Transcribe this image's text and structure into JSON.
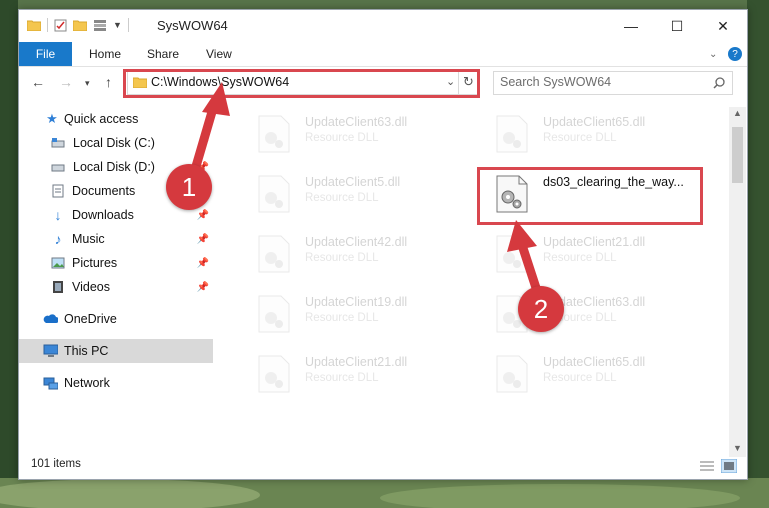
{
  "window": {
    "title": "SysWOW64",
    "minimize_glyph": "—",
    "maximize_glyph": "☐",
    "close_glyph": "✕"
  },
  "ribbon": {
    "tabs": [
      "File",
      "Home",
      "Share",
      "View"
    ]
  },
  "nav": {
    "address": "C:\\Windows\\SysWOW64",
    "search_placeholder": "Search SysWOW64"
  },
  "sidebar": {
    "items": [
      {
        "label": "Quick access",
        "icon": "star-icon"
      },
      {
        "label": "Local Disk (C:)",
        "icon": "drive-icon"
      },
      {
        "label": "Local Disk (D:)",
        "icon": "drive-icon"
      },
      {
        "label": "Documents",
        "icon": "documents-icon"
      },
      {
        "label": "Downloads",
        "icon": "download-icon"
      },
      {
        "label": "Music",
        "icon": "music-icon"
      },
      {
        "label": "Pictures",
        "icon": "pictures-icon"
      },
      {
        "label": "Videos",
        "icon": "videos-icon"
      },
      {
        "label": "OneDrive",
        "icon": "cloud-icon"
      },
      {
        "label": "This PC",
        "icon": "computer-icon"
      },
      {
        "label": "Network",
        "icon": "network-icon"
      }
    ]
  },
  "files": [
    {
      "name": "UpdateClient63.dll",
      "type": "Resource DLL"
    },
    {
      "name": "UpdateClient65.dll",
      "type": "Resource DLL"
    },
    {
      "name": "UpdateClient5.dll",
      "type": "Resource DLL"
    },
    {
      "name": "ds03_clearing_the_way...",
      "type": ""
    },
    {
      "name": "UpdateClient42.dll",
      "type": "Resource DLL"
    },
    {
      "name": "UpdateClient21.dll",
      "type": "Resource DLL"
    },
    {
      "name": "UpdateClient19.dll",
      "type": "Resource DLL"
    },
    {
      "name": "UpdateClient63.dll",
      "type": "Resource DLL"
    },
    {
      "name": "UpdateClient21.dll",
      "type": "Resource DLL"
    },
    {
      "name": "UpdateClient65.dll",
      "type": "Resource DLL"
    }
  ],
  "status": {
    "item_count": "101 items"
  },
  "annotations": {
    "step1": "1",
    "step2": "2"
  },
  "colors": {
    "accent_blue": "#1979ca",
    "highlight_red": "#d9474f",
    "selected_gray": "#d9d9d9"
  }
}
